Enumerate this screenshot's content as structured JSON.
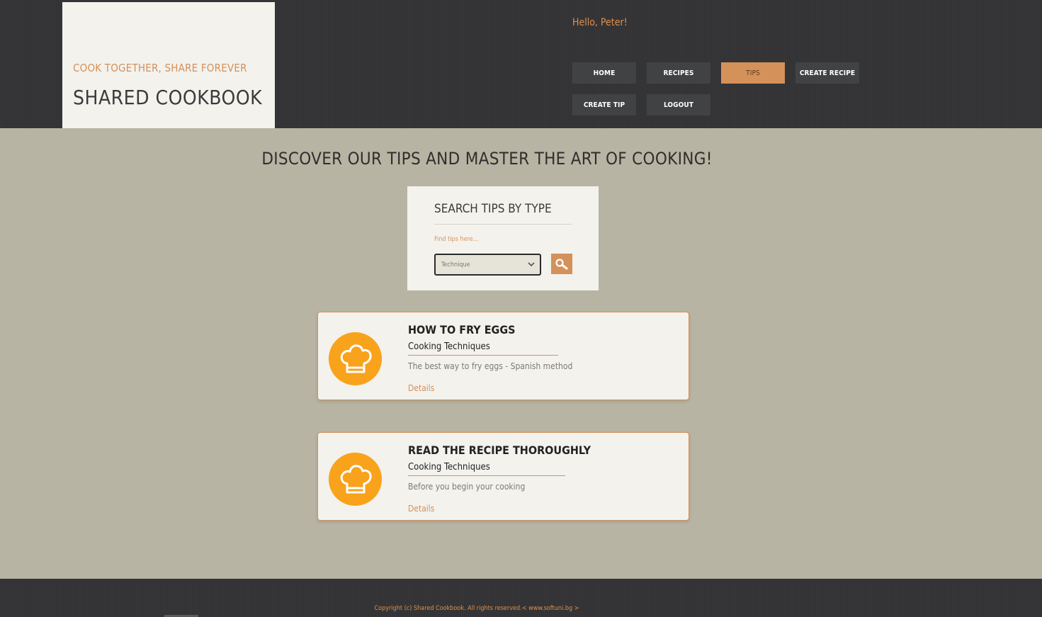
{
  "header": {
    "tagline": "COOK TOGETHER, SHARE FOREVER",
    "site_title": "SHARED COOKBOOK",
    "greeting": "Hello, Peter!",
    "nav": [
      {
        "label": "HOME",
        "active": false
      },
      {
        "label": "RECIPES",
        "active": false
      },
      {
        "label": "TIPS",
        "active": true
      },
      {
        "label": "CREATE RECIPE",
        "active": false
      },
      {
        "label": "CREATE TIP",
        "active": false
      },
      {
        "label": "LOGOUT",
        "active": false
      }
    ]
  },
  "main": {
    "heading": "DISCOVER OUR TIPS AND MASTER THE ART OF COOKING!",
    "search": {
      "title": "SEARCH TIPS BY TYPE",
      "label": "Find tips here...",
      "selected": "Technique",
      "button_icon": "search-icon"
    },
    "tips": [
      {
        "title": "HOW TO FRY EGGS",
        "type": "Cooking Techniques",
        "description": "The best way to fry eggs - Spanish method",
        "details_label": "Details",
        "icon": "chef-hat-icon"
      },
      {
        "title": "READ THE RECIPE THOROUGHLY",
        "type": "Cooking Techniques",
        "description": "Before you begin your cooking",
        "details_label": "Details",
        "icon": "chef-hat-icon"
      }
    ]
  },
  "footer": {
    "copyright": "Copyright (c) Shared Cookbook. All rights reserved.< www.softuni.bg >"
  },
  "colors": {
    "accent": "#d4915a",
    "icon_bg": "#f9a21b",
    "header_bg": "#333335",
    "page_bg": "#b8b4a3",
    "panel_bg": "#f3f2ed"
  }
}
